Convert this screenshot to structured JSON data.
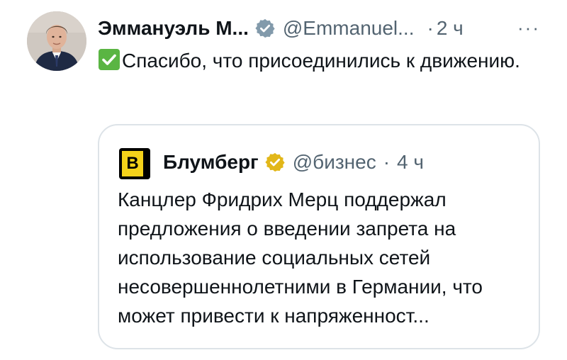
{
  "post": {
    "author_name": "Эммануэль М...",
    "author_handle": "@Emmanuel...",
    "separator": "·",
    "time": "2 ч",
    "more_label": "···",
    "text": "Спасибо, что присоединились к движению.",
    "emoji": "check-mark-button-icon",
    "verified_icon": "verified-badge-icon",
    "verified_color": "#829aab"
  },
  "quoted_post": {
    "logo_letter": "B",
    "author_name": "Блумберг",
    "author_handle": "@бизнес",
    "separator": "·",
    "time": "4 ч",
    "text": "Канцлер Фридрих Мерц поддержал предложения о введении запрета на использование социальных сетей несовершеннолетними в Германии, что может привести к напряженност...",
    "verified_icon": "gold-verified-badge-icon",
    "verified_color": "#e2b719"
  },
  "colors": {
    "text": "#0f1419",
    "secondary": "#536471",
    "border": "#dde3e8",
    "check_emoji": "#5ab543",
    "logo_yellow": "#f5d21a"
  }
}
